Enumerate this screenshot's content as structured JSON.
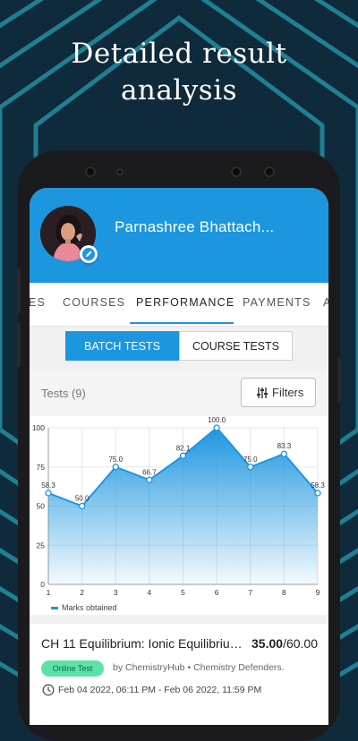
{
  "headline": [
    "Detailed result",
    "analysis"
  ],
  "profile": {
    "name": "Parnashree Bhattach...",
    "edit_icon": "pencil-icon"
  },
  "tabs": [
    {
      "label": "ES"
    },
    {
      "label": "COURSES"
    },
    {
      "label": "PERFORMANCE"
    },
    {
      "label": "PAYMENTS"
    },
    {
      "label": "A"
    }
  ],
  "active_tab": "PERFORMANCE",
  "segment": {
    "batch": "BATCH TESTS",
    "course": "COURSE TESTS",
    "selected": "BATCH TESTS"
  },
  "list": {
    "tests_label": "Tests (9)",
    "filter_label": "Filters",
    "filter_icon": "sliders-icon"
  },
  "colors": {
    "brand": "#1d96e0",
    "badge_bg": "#5be3a5"
  },
  "chart_data": {
    "type": "area",
    "x": [
      1,
      2,
      3,
      4,
      5,
      6,
      7,
      8,
      9
    ],
    "series": [
      {
        "name": "Marks obtained",
        "values": [
          58.3,
          50.0,
          75.0,
          66.7,
          82.1,
          100.0,
          75.0,
          83.3,
          58.3
        ]
      }
    ],
    "point_labels": [
      "58.3",
      "50.0",
      "75.0",
      "66.7",
      "82.1",
      "100.0",
      "75.0",
      "83.3",
      "58.3"
    ],
    "y_ticks": [
      "100",
      "75",
      "50",
      "25",
      "0"
    ],
    "x_ticks": [
      "1",
      "2",
      "3",
      "4",
      "5",
      "6",
      "7",
      "8",
      "9"
    ],
    "ylim": [
      0,
      100
    ],
    "legend": "bottom-left"
  },
  "card": {
    "title": "CH 11 Equilibrium: Ionic Equilibrium ...",
    "score": "35.00",
    "total": "/60.00",
    "badge": "Online Test",
    "by": "by ChemistryHub",
    "separator": "•",
    "group": "Chemistry Defenders.",
    "dates": "Feb 04 2022, 06:11 PM - Feb 06 2022, 11:59 PM",
    "clock_icon": "clock-icon"
  }
}
